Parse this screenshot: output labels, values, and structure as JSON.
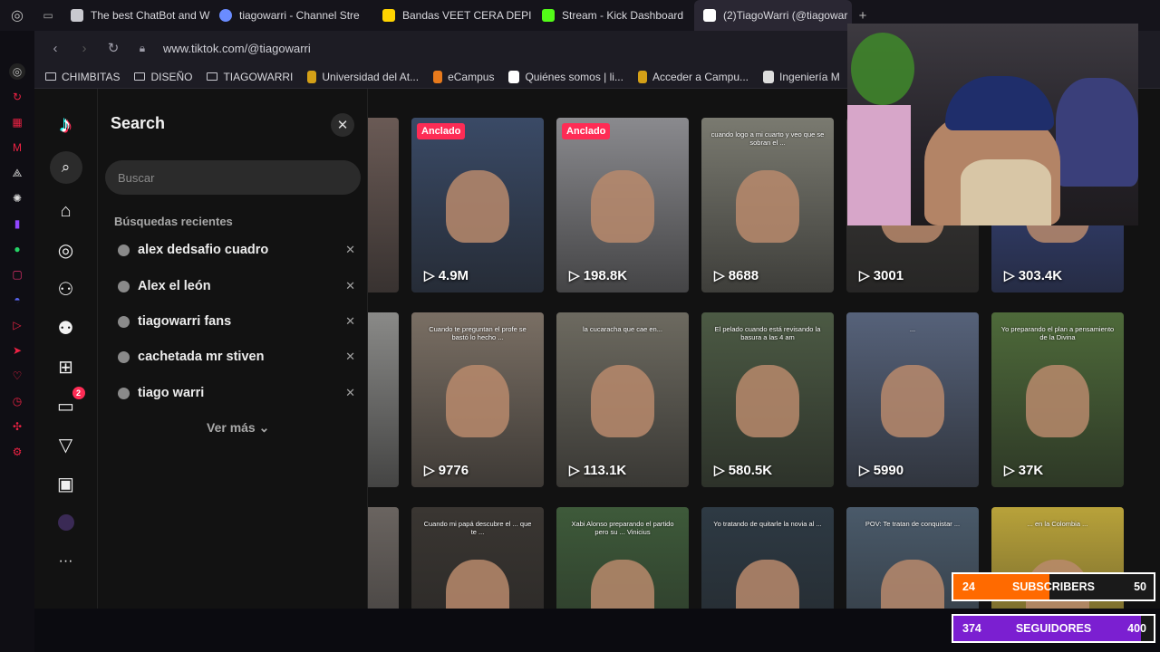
{
  "browser": {
    "tabs": [
      {
        "label": "The best ChatBot and Wi",
        "color": "#c9c9cf"
      },
      {
        "label": "tiagowarri - Channel Stre",
        "color": "#6a8cff"
      },
      {
        "label": "Bandas VEET CERA DEPI",
        "color": "#ffd400"
      },
      {
        "label": "Stream - Kick Dashboard",
        "color": "#53fc18"
      },
      {
        "label": "(2)TiagoWarri (@tiagowar",
        "color": "#ffffff"
      }
    ],
    "new_tab": "+",
    "url": "www.tiktok.com/@tiagowarri",
    "bookmarks": [
      {
        "label": "CHIMBITAS",
        "kind": "folder"
      },
      {
        "label": "DISEÑO",
        "kind": "folder"
      },
      {
        "label": "TIAGOWARRI",
        "kind": "folder"
      },
      {
        "label": "Universidad del At...",
        "kind": "site"
      },
      {
        "label": "eCampus",
        "kind": "site"
      },
      {
        "label": "Quiénes somos | li...",
        "kind": "site"
      },
      {
        "label": "Acceder a Campu...",
        "kind": "site"
      },
      {
        "label": "Ingeniería M",
        "kind": "site"
      }
    ]
  },
  "tiktok_nav": {
    "items": [
      {
        "icon": "tiktok-logo-icon",
        "glyph": "♪"
      },
      {
        "icon": "search-icon",
        "glyph": "⌕"
      },
      {
        "icon": "home-icon",
        "glyph": "⌂"
      },
      {
        "icon": "explore-icon",
        "glyph": "◎"
      },
      {
        "icon": "following-icon",
        "glyph": "👤"
      },
      {
        "icon": "friends-icon",
        "glyph": "👥"
      },
      {
        "icon": "upload-icon",
        "glyph": "⊞"
      },
      {
        "icon": "inbox-icon",
        "glyph": "▭",
        "badge": "2"
      },
      {
        "icon": "messages-icon",
        "glyph": "▽"
      },
      {
        "icon": "live-icon",
        "glyph": "▣"
      },
      {
        "icon": "profile-icon",
        "glyph": "●"
      },
      {
        "icon": "more-icon",
        "glyph": "···"
      }
    ]
  },
  "search": {
    "title": "Search",
    "placeholder": "Buscar",
    "recent_heading": "Búsquedas recientes",
    "recent": [
      "alex dedsafio cuadro",
      "Alex el león",
      "tiagowarri fans",
      "cachetada mr stiven",
      "tiago warri"
    ],
    "see_more": "Ver más"
  },
  "videos": [
    {
      "views": "",
      "pinned": "",
      "caption": "",
      "color": "#6a5a55"
    },
    {
      "views": "4.9M",
      "pinned": "Anclado",
      "caption": "",
      "color": "#3a4a66"
    },
    {
      "views": "198.8K",
      "pinned": "Anclado",
      "caption": "",
      "color": "#8a8a8e"
    },
    {
      "views": "8688",
      "pinned": "",
      "caption": "cuando logo a mi cuarto y veo que se sobran el ...",
      "color": "#7a7a70"
    },
    {
      "views": "3001",
      "pinned": "",
      "caption": "",
      "color": "#3c3a38"
    },
    {
      "views": "303.4K",
      "pinned": "",
      "caption": "",
      "color": "#3a4a8a"
    },
    {
      "views": "",
      "pinned": "",
      "caption": "",
      "color": "#8a8a88"
    },
    {
      "views": "9776",
      "pinned": "",
      "caption": "Cuando te preguntan el profe se bastó lo hecho ...",
      "color": "#7a6f64"
    },
    {
      "views": "113.1K",
      "pinned": "",
      "caption": "la cucaracha que cae en...",
      "color": "#6d6a60"
    },
    {
      "views": "580.5K",
      "pinned": "",
      "caption": "El pelado cuando está revisando la basura a las 4 am",
      "color": "#4c5a44"
    },
    {
      "views": "5990",
      "pinned": "",
      "caption": "...",
      "color": "#56627a"
    },
    {
      "views": "37K",
      "pinned": "",
      "caption": "Yo preparando el plan a pensamiento de la Divina",
      "color": "#4e6a3a"
    },
    {
      "views": "",
      "pinned": "",
      "caption": "",
      "color": "#6a6460"
    },
    {
      "views": "",
      "pinned": "",
      "caption": "Cuando mi papá descubre el ... que te ...",
      "color": "#3a3632"
    },
    {
      "views": "",
      "pinned": "",
      "caption": "Xabi Alonso preparando el partido pero su ... Vinicius",
      "color": "#3e5a3a"
    },
    {
      "views": "",
      "pinned": "",
      "caption": "Yo tratando de quitarle la novia al ...",
      "color": "#2e3a44"
    },
    {
      "views": "",
      "pinned": "",
      "caption": "POV: Te tratan de conquistar ...",
      "color": "#4a5a6a"
    },
    {
      "views": "",
      "pinned": "",
      "caption": "... en la Colombia ...",
      "color": "#b8a23a"
    }
  ],
  "stream_overlay": {
    "subscribers": {
      "current": "24",
      "label": "SUBSCRIBERS",
      "goal": "50",
      "progress": 0.48
    },
    "followers": {
      "current": "374",
      "label": "SEGUIDORES",
      "goal": "400",
      "progress": 0.935
    }
  },
  "colors": {
    "accent": "#fe2c55",
    "subscribers_fill": "#ff6a00",
    "followers_fill": "#7b1fd1"
  }
}
